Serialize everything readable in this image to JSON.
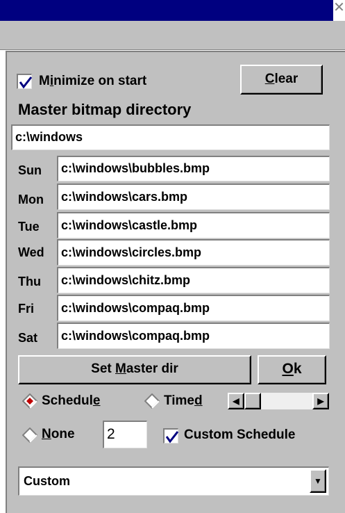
{
  "window": {
    "close_glyph": "✕"
  },
  "options": {
    "minimize_label_pre": "M",
    "minimize_label_u": "i",
    "minimize_label_post": "nimize on start",
    "minimize_checked": true,
    "clear_u": "C",
    "clear_rest": "lear"
  },
  "master": {
    "heading": "Master bitmap directory",
    "directory": "c:\\windows"
  },
  "days": [
    {
      "label": "Sun",
      "path": "c:\\windows\\bubbles.bmp"
    },
    {
      "label": "Mon",
      "path": "c:\\windows\\cars.bmp"
    },
    {
      "label": "Tue",
      "path": "c:\\windows\\castle.bmp"
    },
    {
      "label": "Wed",
      "path": "c:\\windows\\circles.bmp"
    },
    {
      "label": "Thu",
      "path": "c:\\windows\\chitz.bmp"
    },
    {
      "label": "Fri",
      "path": "c:\\windows\\compaq.bmp"
    },
    {
      "label": "Sat",
      "path": "c:\\windows\\compaq.bmp"
    }
  ],
  "actions": {
    "set_master_pre": "Set ",
    "set_master_u": "M",
    "set_master_post": "aster dir",
    "ok_u": "O",
    "ok_rest": "k"
  },
  "mode": {
    "schedule_pre": "Schedul",
    "schedule_u": "e",
    "timed_pre": "Time",
    "timed_u": "d",
    "none_u": "N",
    "none_rest": "one",
    "selected": "schedule",
    "interval_value": "2",
    "custom_schedule_label": "Custom Schedule",
    "custom_schedule_checked": true
  },
  "dropdown": {
    "selected": "Custom"
  },
  "colors": {
    "title_bar": "#000080",
    "face": "#c0c0c0",
    "radio_dot": "#c00000",
    "check": "#000080"
  },
  "icons": [
    "close-icon",
    "checkmark-icon",
    "radio-diamond-icon",
    "arrow-left-icon",
    "arrow-right-icon",
    "dropdown-arrow-icon"
  ]
}
